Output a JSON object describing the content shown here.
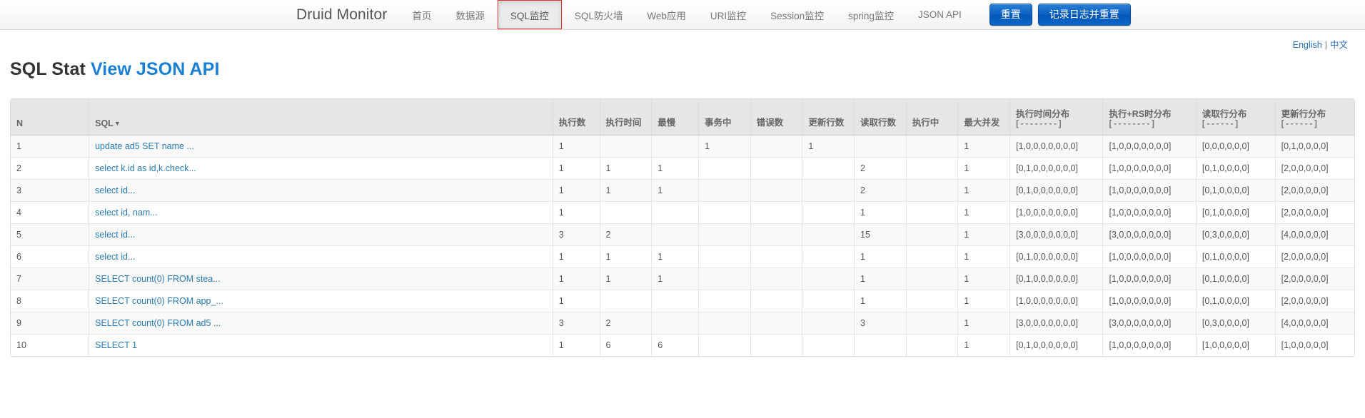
{
  "navbar": {
    "brand": "Druid Monitor",
    "items": [
      {
        "label": "首页",
        "active": false
      },
      {
        "label": "数据源",
        "active": false
      },
      {
        "label": "SQL监控",
        "active": true
      },
      {
        "label": "SQL防火墙",
        "active": false
      },
      {
        "label": "Web应用",
        "active": false
      },
      {
        "label": "URI监控",
        "active": false
      },
      {
        "label": "Session监控",
        "active": false
      },
      {
        "label": "spring监控",
        "active": false
      },
      {
        "label": "JSON API",
        "active": false
      }
    ],
    "buttons": [
      {
        "label": "重置"
      },
      {
        "label": "记录日志并重置"
      }
    ],
    "accent_color": "#0b5fc0",
    "active_outline_color": "#e03030"
  },
  "lang": {
    "english": "English",
    "separator": "|",
    "chinese": "中文",
    "link_color": "#2a6fb5"
  },
  "page": {
    "title": "SQL Stat",
    "json_link": "View JSON API",
    "json_link_color": "#1b7fd4"
  },
  "table": {
    "headers": [
      {
        "label": "N",
        "sub": ""
      },
      {
        "label": "SQL",
        "sub": "",
        "sortable": true,
        "sort_caret": "▼"
      },
      {
        "label": "执行数",
        "sub": ""
      },
      {
        "label": "执行时间",
        "sub": ""
      },
      {
        "label": "最慢",
        "sub": ""
      },
      {
        "label": "事务中",
        "sub": ""
      },
      {
        "label": "错误数",
        "sub": ""
      },
      {
        "label": "更新行数",
        "sub": ""
      },
      {
        "label": "读取行数",
        "sub": ""
      },
      {
        "label": "执行中",
        "sub": ""
      },
      {
        "label": "最大并发",
        "sub": ""
      },
      {
        "label": "执行时间分布",
        "sub": "[ - - - - - - - - ]"
      },
      {
        "label": "执行+RS时分布",
        "sub": "[ - - - - - - - - ]"
      },
      {
        "label": "读取行分布",
        "sub": "[ - - - - - - ]"
      },
      {
        "label": "更新行分布",
        "sub": "[ - - - - - - ]"
      }
    ],
    "rows": [
      {
        "n": "1",
        "sql": "update ad5 SET name ...",
        "exec_count": "1",
        "exec_time": "",
        "slowest": "",
        "in_transaction": "1",
        "error_count": "",
        "update_rows": "1",
        "fetch_rows": "",
        "running": "",
        "max_concurrent": "1",
        "exec_time_dist": "[1,0,0,0,0,0,0,0]",
        "exec_rs_dist": "[1,0,0,0,0,0,0,0]",
        "fetch_row_dist": "[0,0,0,0,0,0]",
        "update_row_dist": "[0,1,0,0,0,0]"
      },
      {
        "n": "2",
        "sql": "select k.id as id,k.check...",
        "exec_count": "1",
        "exec_time": "1",
        "slowest": "1",
        "in_transaction": "",
        "error_count": "",
        "update_rows": "",
        "fetch_rows": "2",
        "running": "",
        "max_concurrent": "1",
        "exec_time_dist": "[0,1,0,0,0,0,0,0]",
        "exec_rs_dist": "[1,0,0,0,0,0,0,0]",
        "fetch_row_dist": "[0,1,0,0,0,0]",
        "update_row_dist": "[2,0,0,0,0,0]"
      },
      {
        "n": "3",
        "sql": "select id...",
        "exec_count": "1",
        "exec_time": "1",
        "slowest": "1",
        "in_transaction": "",
        "error_count": "",
        "update_rows": "",
        "fetch_rows": "2",
        "running": "",
        "max_concurrent": "1",
        "exec_time_dist": "[0,1,0,0,0,0,0,0]",
        "exec_rs_dist": "[1,0,0,0,0,0,0,0]",
        "fetch_row_dist": "[0,1,0,0,0,0]",
        "update_row_dist": "[2,0,0,0,0,0]"
      },
      {
        "n": "4",
        "sql": "select id, nam...",
        "exec_count": "1",
        "exec_time": "",
        "slowest": "",
        "in_transaction": "",
        "error_count": "",
        "update_rows": "",
        "fetch_rows": "1",
        "running": "",
        "max_concurrent": "1",
        "exec_time_dist": "[1,0,0,0,0,0,0,0]",
        "exec_rs_dist": "[1,0,0,0,0,0,0,0]",
        "fetch_row_dist": "[0,1,0,0,0,0]",
        "update_row_dist": "[2,0,0,0,0,0]"
      },
      {
        "n": "5",
        "sql": "select id...",
        "exec_count": "3",
        "exec_time": "2",
        "slowest": "",
        "in_transaction": "",
        "error_count": "",
        "update_rows": "",
        "fetch_rows": "15",
        "running": "",
        "max_concurrent": "1",
        "exec_time_dist": "[3,0,0,0,0,0,0,0]",
        "exec_rs_dist": "[3,0,0,0,0,0,0,0]",
        "fetch_row_dist": "[0,3,0,0,0,0]",
        "update_row_dist": "[4,0,0,0,0,0]"
      },
      {
        "n": "6",
        "sql": "select id...",
        "exec_count": "1",
        "exec_time": "1",
        "slowest": "1",
        "in_transaction": "",
        "error_count": "",
        "update_rows": "",
        "fetch_rows": "1",
        "running": "",
        "max_concurrent": "1",
        "exec_time_dist": "[0,1,0,0,0,0,0,0]",
        "exec_rs_dist": "[1,0,0,0,0,0,0,0]",
        "fetch_row_dist": "[0,1,0,0,0,0]",
        "update_row_dist": "[2,0,0,0,0,0]"
      },
      {
        "n": "7",
        "sql": "SELECT count(0) FROM stea...",
        "exec_count": "1",
        "exec_time": "1",
        "slowest": "1",
        "in_transaction": "",
        "error_count": "",
        "update_rows": "",
        "fetch_rows": "1",
        "running": "",
        "max_concurrent": "1",
        "exec_time_dist": "[0,1,0,0,0,0,0,0]",
        "exec_rs_dist": "[1,0,0,0,0,0,0,0]",
        "fetch_row_dist": "[0,1,0,0,0,0]",
        "update_row_dist": "[2,0,0,0,0,0]"
      },
      {
        "n": "8",
        "sql": "SELECT count(0) FROM app_...",
        "exec_count": "1",
        "exec_time": "",
        "slowest": "",
        "in_transaction": "",
        "error_count": "",
        "update_rows": "",
        "fetch_rows": "1",
        "running": "",
        "max_concurrent": "1",
        "exec_time_dist": "[1,0,0,0,0,0,0,0]",
        "exec_rs_dist": "[1,0,0,0,0,0,0,0]",
        "fetch_row_dist": "[0,1,0,0,0,0]",
        "update_row_dist": "[2,0,0,0,0,0]"
      },
      {
        "n": "9",
        "sql": "SELECT count(0) FROM ad5 ...",
        "exec_count": "3",
        "exec_time": "2",
        "slowest": "",
        "in_transaction": "",
        "error_count": "",
        "update_rows": "",
        "fetch_rows": "3",
        "running": "",
        "max_concurrent": "1",
        "exec_time_dist": "[3,0,0,0,0,0,0,0]",
        "exec_rs_dist": "[3,0,0,0,0,0,0,0]",
        "fetch_row_dist": "[0,3,0,0,0,0]",
        "update_row_dist": "[4,0,0,0,0,0]"
      },
      {
        "n": "10",
        "sql": "SELECT 1",
        "exec_count": "1",
        "exec_time": "6",
        "slowest": "6",
        "in_transaction": "",
        "error_count": "",
        "update_rows": "",
        "fetch_rows": "",
        "running": "",
        "max_concurrent": "1",
        "exec_time_dist": "[0,1,0,0,0,0,0,0]",
        "exec_rs_dist": "[1,0,0,0,0,0,0,0]",
        "fetch_row_dist": "[1,0,0,0,0,0]",
        "update_row_dist": "[1,0,0,0,0,0]"
      }
    ]
  }
}
